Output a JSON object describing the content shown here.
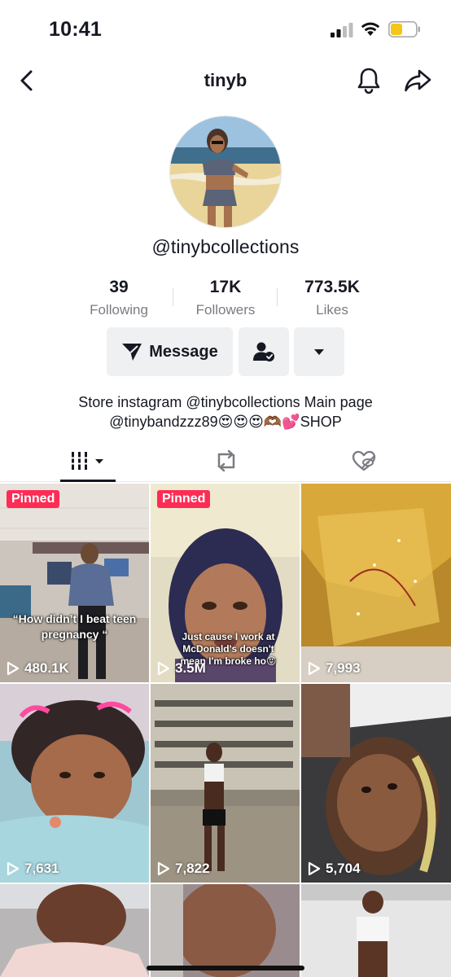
{
  "status_bar": {
    "time": "10:41",
    "icons": [
      "cellular-signal-icon",
      "wifi-icon",
      "battery-icon"
    ]
  },
  "nav": {
    "title": "tinyb",
    "icons": [
      "back-chevron-icon",
      "bell-icon",
      "share-arrow-icon"
    ]
  },
  "profile": {
    "handle": "@tinybcollections",
    "stats": [
      {
        "value": "39",
        "label": "Following"
      },
      {
        "value": "17K",
        "label": "Followers"
      },
      {
        "value": "773.5K",
        "label": "Likes"
      }
    ],
    "message_label": "Message",
    "bio_line1": "Store instagram @tinybcollections Main page",
    "bio_line2": "@tinybandzzz89😍😍😍🫶🏾💕SHOP"
  },
  "tabs": [
    {
      "name": "videos",
      "icon": "grid-bars-icon",
      "active": true
    },
    {
      "name": "reposts",
      "icon": "repost-icon",
      "active": false
    },
    {
      "name": "liked",
      "icon": "hidden-heart-icon",
      "active": false
    }
  ],
  "videos": [
    {
      "pinned_label": "Pinned",
      "views": "480.1K",
      "caption": "“How didn’t I beat teen pregnancy “"
    },
    {
      "pinned_label": "Pinned",
      "views": "3.5M",
      "caption": "Just cause I work at McDonald's doesn't mean I'm broke ho😝"
    },
    {
      "views": "7,993"
    },
    {
      "views": "7,631"
    },
    {
      "views": "7,822"
    },
    {
      "views": "5,704"
    }
  ],
  "colors": {
    "accent": "#fe2c55",
    "text": "#161823",
    "secondary_text": "#7a7b82",
    "button_bg": "#eff0f1"
  }
}
